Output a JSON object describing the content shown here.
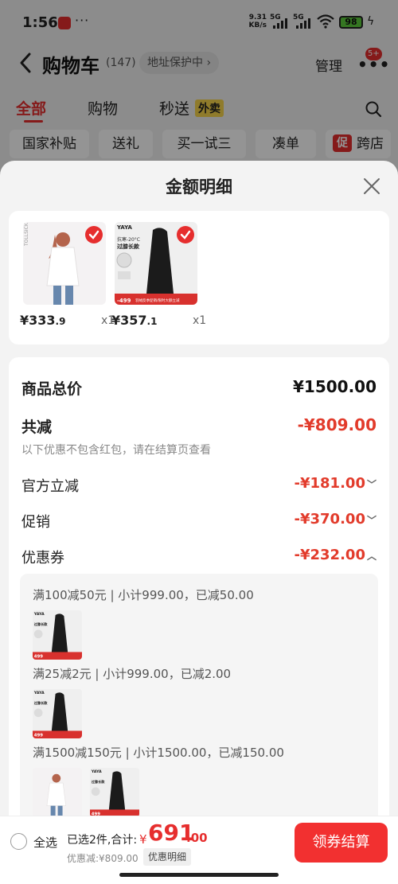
{
  "status_bar": {
    "time": "1:56",
    "dots": "···",
    "net_speed_top": "9.31",
    "net_speed_bottom": "KB/s",
    "sig1": "5G",
    "sig2": "5G",
    "battery": "98"
  },
  "header": {
    "title": "购物车",
    "count": "(147)",
    "address_pill": "地址保护中 ›",
    "manage": "管理",
    "badge": "5+"
  },
  "tabs": {
    "all": "全部",
    "shopping": "购物",
    "instant": "秒送",
    "waimai": "外卖"
  },
  "chips": [
    "国家补贴",
    "送礼",
    "买一试三",
    "凑单",
    "跨店"
  ],
  "chip_cu": "促",
  "sheet": {
    "title": "金额明细"
  },
  "goods": [
    {
      "price_int": "¥333",
      "price_dec": ".9",
      "qty": "x1"
    },
    {
      "price_int": "¥357",
      "price_dec": ".1",
      "qty": "x1"
    }
  ],
  "detail": {
    "total_label": "商品总价",
    "total_value": "¥1500.00",
    "reduce_label": "共减",
    "reduce_value": "-¥809.00",
    "reduce_note": "以下优惠不包含红包，请在结算页查看",
    "official_label": "官方立减",
    "official_value": "-¥181.00",
    "promo_label": "促销",
    "promo_value": "-¥370.00",
    "coupon_label": "优惠券",
    "coupon_value": "-¥232.00"
  },
  "coupon_rules": [
    "满100减50元 | 小计999.00，已减50.00",
    "满25减2元 | 小计999.00，已减2.00",
    "满1500减150元 | 小计1500.00，已减150.00"
  ],
  "bottom": {
    "select_all": "全选",
    "selected": "已选2件,合计:",
    "yen": "¥",
    "total_int": "691",
    "total_dec": ".00",
    "discount": "优惠减:¥809.00",
    "detail_pill": "优惠明细",
    "checkout": "领券结算"
  },
  "colors": {
    "accent": "#e62e2e",
    "price_red": "#e23b2b",
    "sheet_bg": "#f3f3f3"
  }
}
